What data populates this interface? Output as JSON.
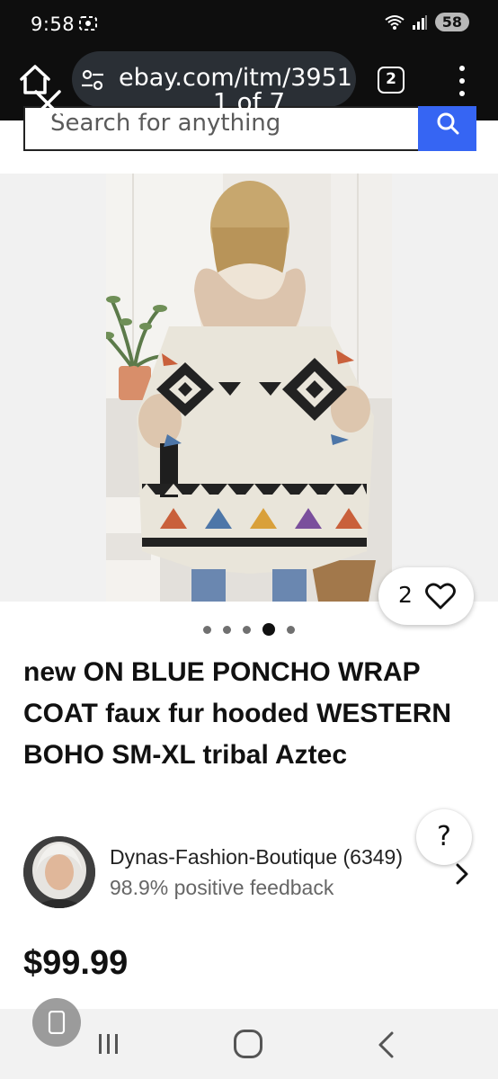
{
  "status": {
    "time": "9:58",
    "battery": "58"
  },
  "browser": {
    "url": "ebay.com/itm/3951",
    "tab_count": "2"
  },
  "viewer": {
    "counter": "1 of 7"
  },
  "search": {
    "placeholder": "Search for anything"
  },
  "listing": {
    "favorites": "2",
    "image_count": 5,
    "active_image": 4,
    "title": "new ON BLUE PONCHO WRAP COAT faux fur hooded WESTERN BOHO SM-XL tribal Aztec",
    "price": "$99.99"
  },
  "seller": {
    "name": "Dynas-Fashion-Boutique (6349)",
    "feedback": "98.9% positive feedback"
  },
  "help": {
    "label": "?"
  },
  "colors": {
    "accent": "#3665f3",
    "toolbar": "#0e0e0e"
  },
  "icons": [
    "home-icon",
    "tune-icon",
    "menu-icon",
    "close-icon",
    "search-icon",
    "heart-icon",
    "chevron-right-icon",
    "nav-recent-icon",
    "nav-home-icon",
    "nav-back-icon"
  ]
}
